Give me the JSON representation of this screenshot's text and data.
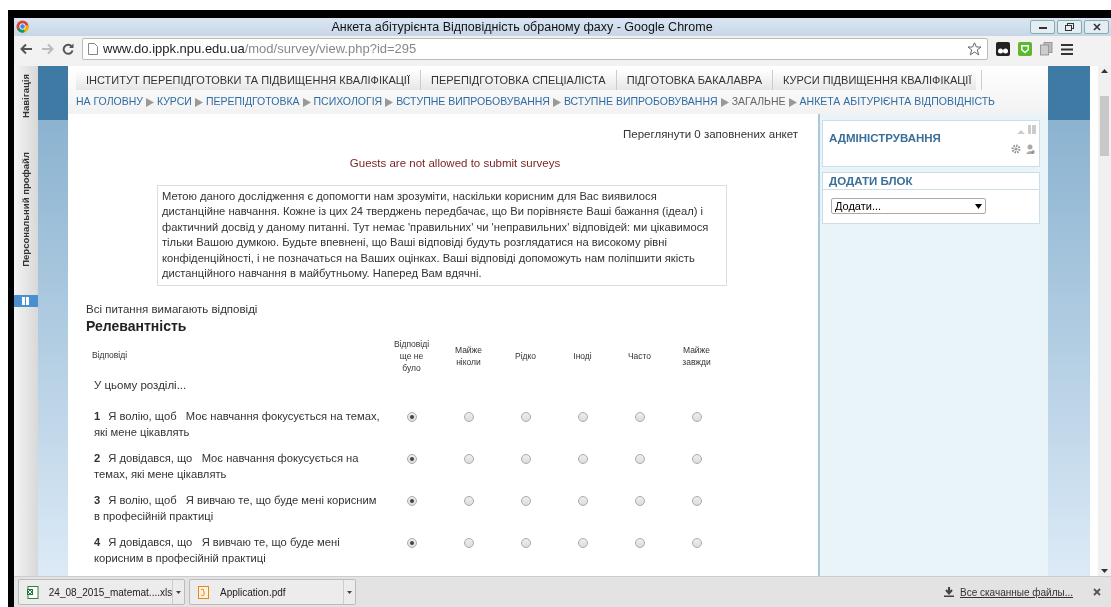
{
  "window": {
    "title": "Анкета абітурієнта Відповідність обраному фаху - Google Chrome"
  },
  "toolbar": {
    "url_host": "www.do.ippk.npu.edu.ua",
    "url_path": "/mod/survey/view.php?id=295"
  },
  "side_tabs": [
    "Навігація",
    "Персональний профайл"
  ],
  "nav_menu": [
    "ІНСТИТУТ ПЕРЕПІДГОТОВКИ ТА ПІДВИЩЕННЯ КВАЛІФІКАЦІЇ",
    "ПЕРЕПІДГОТОВКА СПЕЦІАЛІСТА",
    "ПІДГОТОВКА БАКАЛАВРА",
    "КУРСИ ПІДВИЩЕННЯ КВАЛІФІКАЦІЇ"
  ],
  "breadcrumb": [
    {
      "label": "НА ГОЛОВНУ",
      "link": true
    },
    {
      "label": "КУРСИ",
      "link": true
    },
    {
      "label": "ПЕРЕПІДГОТОВКА",
      "link": true
    },
    {
      "label": "ПСИХОЛОГІЯ",
      "link": true
    },
    {
      "label": "ВСТУПНЕ ВИПРОБОВУВАННЯ",
      "link": true
    },
    {
      "label": "ВСТУПНЕ ВИПРОБОВУВАННЯ",
      "link": true
    },
    {
      "label": "ЗАГАЛЬНЕ",
      "link": false
    },
    {
      "label": "АНКЕТА АБІТУРІЄНТА ВІДПОВІДНІСТЬ",
      "link": true
    }
  ],
  "view_link": "Переглянути 0 заповнених анкет",
  "notice": "Guests are not allowed to submit surveys",
  "intro": "Метою даного дослідження є допомогти нам зрозуміти, наскільки корисним для Вас виявилося дистанційне навчання. Кожне із цих 24 тверджень передбачає, що Ви порівняєте Ваші бажання (ідеал) і фактичний досвід у даному питанні. Тут немає 'правильних' чи 'неправильних' відповідей: ми цікавимося тільки Вашою думкою. Будьте впевнені, що Ваші відповіді будуть розглядатися на високому рівні конфіденційності, і не позначаться на Ваших оцінках. Ваші відповіді допоможуть нам поліпшити якість дистанційного навчання в майбутньому. Наперед Вам вдячні.",
  "required_note": "Всі питання вимагають відповіді",
  "section_title": "Релевантність",
  "table": {
    "label_column": "Відповіді",
    "columns": [
      "Відповіді ще не було",
      "Майже ніколи",
      "Рідко",
      "Іноді",
      "Часто",
      "Майже завжди"
    ],
    "section_intro": "У цьому розділі...",
    "questions": [
      {
        "number": "1",
        "text": "Я волію, щоб   Моє навчання фокусується на темах, які мене цікавлять",
        "answers": [
          {
            "selected": true
          },
          {
            "selected": false
          },
          {
            "selected": false
          },
          {
            "selected": false
          },
          {
            "selected": false
          },
          {
            "selected": false
          }
        ]
      },
      {
        "number": "2",
        "text": "Я довідався, що   Моє навчання фокусується на темах, які мене цікавлять",
        "answers": [
          {
            "selected": true
          },
          {
            "selected": false
          },
          {
            "selected": false
          },
          {
            "selected": false
          },
          {
            "selected": false
          },
          {
            "selected": false
          }
        ]
      },
      {
        "number": "3",
        "text": "Я волію, щоб   Я вивчаю те, що буде мені корисним в професійній практиці",
        "answers": [
          {
            "selected": true
          },
          {
            "selected": false
          },
          {
            "selected": false
          },
          {
            "selected": false
          },
          {
            "selected": false
          },
          {
            "selected": false
          }
        ]
      },
      {
        "number": "4",
        "text": "Я довідався, що   Я вивчаю те, що буде мені корисним в професійній практиці",
        "answers": [
          {
            "selected": true
          },
          {
            "selected": false
          },
          {
            "selected": false
          },
          {
            "selected": false
          },
          {
            "selected": false
          },
          {
            "selected": false
          }
        ]
      }
    ]
  },
  "blocks": {
    "admin_title": "АДМІНІСТРУВАННЯ",
    "add_block_title": "ДОДАТИ БЛОК",
    "add_block_select": "Додати..."
  },
  "downloads": {
    "items": [
      {
        "name": "24_08_2015_matemat....xls",
        "kind": "xls"
      },
      {
        "name": "Application.pdf",
        "kind": "pdf"
      }
    ],
    "all_link": "Все скачанные файлы..."
  }
}
